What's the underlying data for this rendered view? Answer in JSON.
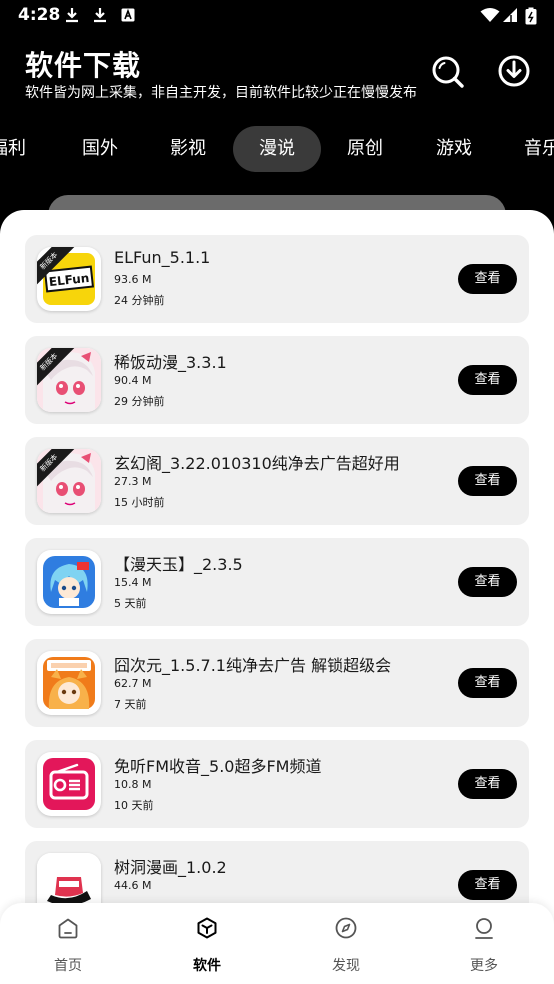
{
  "status": {
    "time": "4:28"
  },
  "header": {
    "title": "软件下载",
    "subtitle": "软件皆为网上采集，非自主开发，目前软件比较少正在慢慢发布"
  },
  "tabs": [
    {
      "label": "福利"
    },
    {
      "label": "国外"
    },
    {
      "label": "影视"
    },
    {
      "label": "漫说",
      "active": true
    },
    {
      "label": "原创"
    },
    {
      "label": "游戏"
    },
    {
      "label": "音乐"
    }
  ],
  "list": {
    "badge_text": "新版本",
    "view_label": "查看",
    "items": [
      {
        "name": "ELFun_5.1.1",
        "size": "93.6 M",
        "time": "24 分钟前",
        "icon": "elfun-icon",
        "badge": true
      },
      {
        "name": "稀饭动漫_3.3.1",
        "size": "90.4 M",
        "time": "29 分钟前",
        "icon": "anime-girl-icon",
        "badge": true
      },
      {
        "name": "玄幻阁_3.22.010310纯净去广告超好用",
        "size": "27.3 M",
        "time": "15 小时前",
        "icon": "anime-girl-icon",
        "badge": true
      },
      {
        "name": "【漫天玉】_2.3.5",
        "size": "15.4 M",
        "time": "5 天前",
        "icon": "blue-hair-character-icon",
        "badge": false
      },
      {
        "name": "囧次元_1.5.7.1纯净去广告 解锁超级会",
        "size": "62.7 M",
        "time": "7 天前",
        "icon": "jiongciyuan-icon",
        "badge": false
      },
      {
        "name": "免听FM收音_5.0超多FM频道",
        "size": "10.8 M",
        "time": "10 天前",
        "icon": "radio-icon",
        "badge": false
      },
      {
        "name": "树洞漫画_1.0.2",
        "size": "44.6 M",
        "time": "",
        "icon": "pirate-hat-icon",
        "badge": false
      }
    ]
  },
  "bottom_nav": [
    {
      "label": "首页",
      "icon": "home-icon"
    },
    {
      "label": "软件",
      "icon": "software-box-icon",
      "active": true
    },
    {
      "label": "发现",
      "icon": "compass-icon"
    },
    {
      "label": "更多",
      "icon": "more-person-icon"
    }
  ],
  "colors": {
    "background": "#000000",
    "sheet": "#ffffff",
    "card": "#f0f0f0",
    "active_tab": "#3a3a3a",
    "button": "#000000"
  }
}
